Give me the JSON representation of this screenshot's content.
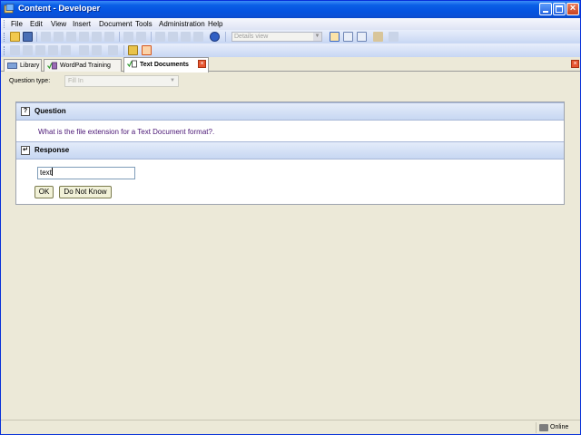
{
  "window": {
    "title": "Content - Developer"
  },
  "menubar": {
    "items": [
      "File",
      "Edit",
      "View",
      "Insert",
      "Document",
      "Tools",
      "Administration",
      "Help"
    ]
  },
  "toolbar": {
    "view_select": "Details view"
  },
  "tabs": [
    {
      "label": "Library",
      "active": false
    },
    {
      "label": "WordPad Training",
      "active": false
    },
    {
      "label": "Text Documents",
      "active": true
    }
  ],
  "question_type": {
    "label": "Question type:",
    "value": "Fill In"
  },
  "question": {
    "header": "Question",
    "text": "What is the file extension for a Text Document format?."
  },
  "response": {
    "header": "Response",
    "input_value": "text",
    "ok_label": "OK",
    "dont_know_label": "Do Not Know"
  },
  "status": {
    "connection": "Online"
  },
  "colors": {
    "title_bar": "#0553e0",
    "section_header": "#c7d7f2",
    "question_text": "#4a1675"
  }
}
